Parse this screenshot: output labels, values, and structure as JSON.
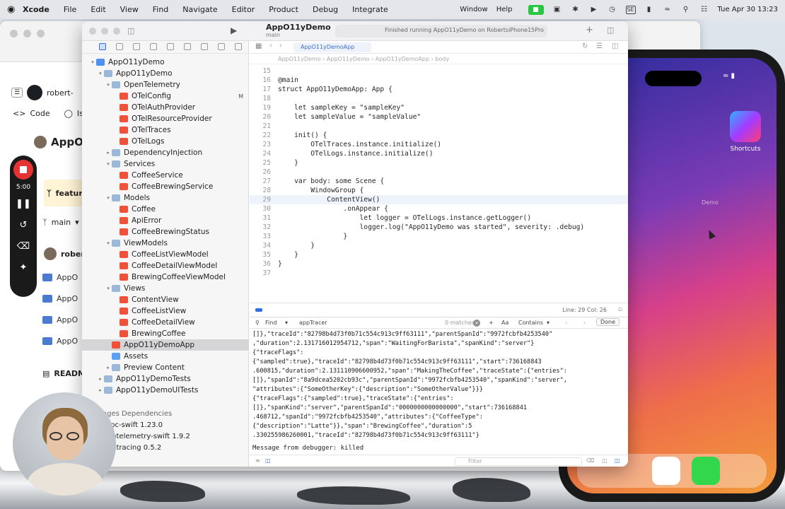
{
  "menubar": {
    "app_name": "Xcode",
    "items": [
      "File",
      "Edit",
      "View",
      "Find",
      "Navigate",
      "Editor",
      "Product",
      "Debug",
      "Integrate"
    ],
    "right_items": [
      "Window",
      "Help"
    ],
    "clock": "Tue Apr 30  13:23",
    "input_badge": "SE"
  },
  "browser": {
    "gh_user_fragment": "robert-",
    "code_tab": "Code",
    "issues_tab": "Issu",
    "repo_fragment": "AppO",
    "branch_banner": "feature",
    "branch": "main",
    "author_fragment": "robert",
    "folders": [
      "AppO",
      "AppO",
      "AppO",
      "AppO"
    ],
    "readme": "READM",
    "packages_header": "ages Dependencies",
    "packages": [
      "rpc-swift 1.23.0",
      "entelemetry-swift 1.9.2",
      "entracing 0.5.2"
    ],
    "right_counter": "0",
    "right_text": "ics"
  },
  "recording": {
    "time": "5:00"
  },
  "iphone": {
    "shortcuts_label": "Shortcuts",
    "demo_label": "Demo"
  },
  "xcode": {
    "scheme_title": "AppO11yDemo",
    "scheme_sub": "main",
    "status_text": "Finished running AppO11yDemo on RobertsiPhone15Pro",
    "editor_tab": "AppO11yDemoApp",
    "breadcrumb": "AppO11yDemo  ›  AppO11yDemo  ›  AppO11yDemoApp  ›  body",
    "cursor_pos": "Line: 29  Col: 26",
    "navigator": [
      {
        "label": "AppO11yDemo",
        "indent": 0,
        "icon": "proj",
        "disc": "▾",
        "mod": ""
      },
      {
        "label": "AppO11yDemo",
        "indent": 1,
        "icon": "folder",
        "disc": "▾",
        "mod": ""
      },
      {
        "label": "OpenTelemetry",
        "indent": 2,
        "icon": "folder",
        "disc": "▾",
        "mod": ""
      },
      {
        "label": "OTelConfig",
        "indent": 3,
        "icon": "swift",
        "disc": "",
        "mod": "M"
      },
      {
        "label": "OTelAuthProvider",
        "indent": 3,
        "icon": "swift",
        "disc": "",
        "mod": ""
      },
      {
        "label": "OTelResourceProvider",
        "indent": 3,
        "icon": "swift",
        "disc": "",
        "mod": ""
      },
      {
        "label": "OTelTraces",
        "indent": 3,
        "icon": "swift",
        "disc": "",
        "mod": ""
      },
      {
        "label": "OTelLogs",
        "indent": 3,
        "icon": "swift",
        "disc": "",
        "mod": ""
      },
      {
        "label": "DependencyInjection",
        "indent": 2,
        "icon": "folder",
        "disc": "▸",
        "mod": ""
      },
      {
        "label": "Services",
        "indent": 2,
        "icon": "folder",
        "disc": "▾",
        "mod": ""
      },
      {
        "label": "CoffeeService",
        "indent": 3,
        "icon": "swift",
        "disc": "",
        "mod": ""
      },
      {
        "label": "CoffeeBrewingService",
        "indent": 3,
        "icon": "swift",
        "disc": "",
        "mod": ""
      },
      {
        "label": "Models",
        "indent": 2,
        "icon": "folder",
        "disc": "▾",
        "mod": ""
      },
      {
        "label": "Coffee",
        "indent": 3,
        "icon": "swift",
        "disc": "",
        "mod": ""
      },
      {
        "label": "ApiError",
        "indent": 3,
        "icon": "swift",
        "disc": "",
        "mod": ""
      },
      {
        "label": "CoffeeBrewingStatus",
        "indent": 3,
        "icon": "swift",
        "disc": "",
        "mod": ""
      },
      {
        "label": "ViewModels",
        "indent": 2,
        "icon": "folder",
        "disc": "▾",
        "mod": ""
      },
      {
        "label": "CoffeeListViewModel",
        "indent": 3,
        "icon": "swift",
        "disc": "",
        "mod": ""
      },
      {
        "label": "CoffeeDetailViewModel",
        "indent": 3,
        "icon": "swift",
        "disc": "",
        "mod": ""
      },
      {
        "label": "BrewingCoffeeViewModel",
        "indent": 3,
        "icon": "swift",
        "disc": "",
        "mod": ""
      },
      {
        "label": "Views",
        "indent": 2,
        "icon": "folder",
        "disc": "▾",
        "mod": ""
      },
      {
        "label": "ContentView",
        "indent": 3,
        "icon": "swift",
        "disc": "",
        "mod": ""
      },
      {
        "label": "CoffeeListView",
        "indent": 3,
        "icon": "swift",
        "disc": "",
        "mod": ""
      },
      {
        "label": "CoffeeDetailView",
        "indent": 3,
        "icon": "swift",
        "disc": "",
        "mod": ""
      },
      {
        "label": "BrewingCoffee",
        "indent": 3,
        "icon": "swift",
        "disc": "",
        "mod": ""
      },
      {
        "label": "AppO11yDemoApp",
        "indent": 2,
        "icon": "swift",
        "disc": "",
        "mod": "",
        "selected": true
      },
      {
        "label": "Assets",
        "indent": 2,
        "icon": "assets",
        "disc": "",
        "mod": ""
      },
      {
        "label": "Preview Content",
        "indent": 2,
        "icon": "folder",
        "disc": "▸",
        "mod": ""
      },
      {
        "label": "AppO11yDemoTests",
        "indent": 1,
        "icon": "folder",
        "disc": "▸",
        "mod": ""
      },
      {
        "label": "AppO11yDemoUITests",
        "indent": 1,
        "icon": "folder",
        "disc": "▸",
        "mod": ""
      }
    ],
    "code": [
      {
        "n": "15",
        "t": ""
      },
      {
        "n": "16",
        "t": "@main"
      },
      {
        "n": "17",
        "t": "struct AppO11yDemoApp: App {"
      },
      {
        "n": "18",
        "t": ""
      },
      {
        "n": "19",
        "t": "    let sampleKey = \"sampleKey\""
      },
      {
        "n": "20",
        "t": "    let sampleValue = \"sampleValue\""
      },
      {
        "n": "21",
        "t": ""
      },
      {
        "n": "22",
        "t": "    init() {"
      },
      {
        "n": "23",
        "t": "        OTelTraces.instance.initialize()"
      },
      {
        "n": "24",
        "t": "        OTelLogs.instance.initialize()"
      },
      {
        "n": "25",
        "t": "    }"
      },
      {
        "n": "26",
        "t": ""
      },
      {
        "n": "27",
        "t": "    var body: some Scene {"
      },
      {
        "n": "28",
        "t": "        WindowGroup {"
      },
      {
        "n": "29",
        "t": "            ContentView()",
        "cur": true
      },
      {
        "n": "30",
        "t": "                .onAppear {"
      },
      {
        "n": "31",
        "t": "                    let logger = OTelLogs.instance.getLogger()"
      },
      {
        "n": "32",
        "t": "                    logger.log(\"AppO11yDemo was started\", severity: .debug)"
      },
      {
        "n": "33",
        "t": "                }"
      },
      {
        "n": "34",
        "t": "        }"
      },
      {
        "n": "35",
        "t": "    }"
      },
      {
        "n": "36",
        "t": "}"
      },
      {
        "n": "37",
        "t": ""
      }
    ],
    "find": {
      "label": "Find",
      "query": "appTracer",
      "matches": "0 matches",
      "aa": "Aa",
      "mode": "Contains",
      "done": "Done"
    },
    "console": [
      "[]},\"traceId\":\"82798b4d73f0b71c554c913c9ff63111\",\"parentSpanId\":\"9972fcbfb4253540\"",
      ",\"duration\":2.131716012954712,\"span\":\"WaitingForBarista\",\"spanKind\":\"server\"}",
      "{\"traceFlags\":",
      "{\"sampled\":true},\"traceId\":\"82798b4d73f0b71c554c913c9ff63111\",\"start\":736168843",
      ".600815,\"duration\":2.131110906600952,\"span\":\"MakingTheCoffee\",\"traceState\":{\"entries\":",
      "[]},\"spanId\":\"8a9dcea5202cb93c\",\"parentSpanId\":\"9972fcbfb4253540\",\"spanKind\":\"server\",",
      "\"attributes\":{\"SomeOtherKey\":{\"description\":\"SomeOtherValue\"}}}",
      "{\"traceFlags\":{\"sampled\":true},\"traceState\":{\"entries\":",
      "[]},\"spanKind\":\"server\",\"parentSpanId\":\"0000000000000000\",\"start\":736168841",
      ".468712,\"spanId\":\"9972fcbfb4253540\",\"attributes\":{\"CoffeeType\":",
      "{\"description\":\"Latte\"}},\"span\":\"BrewingCoffee\",\"duration\":5",
      ".330255986260001,\"traceId\":\"82798b4d73f0b71c554c913c9ff63111\"}"
    ],
    "debugger_message": "Message from debugger: killed",
    "filter_placeholder": "Filter"
  }
}
